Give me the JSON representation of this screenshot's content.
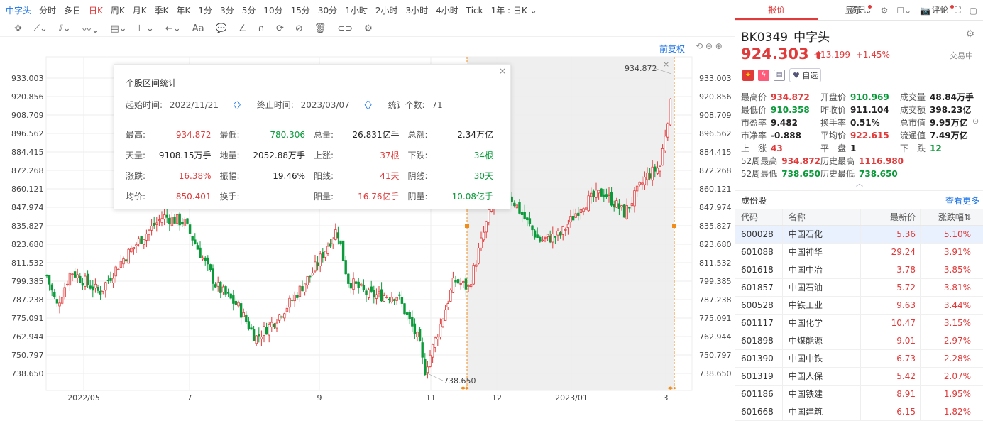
{
  "topbar": {
    "items": [
      {
        "label": "中字头",
        "state": "active"
      },
      {
        "label": "分时"
      },
      {
        "label": "多日"
      },
      {
        "label": "日K",
        "state": "red"
      },
      {
        "label": "周K"
      },
      {
        "label": "月K"
      },
      {
        "label": "季K"
      },
      {
        "label": "年K"
      },
      {
        "label": "1分"
      },
      {
        "label": "3分"
      },
      {
        "label": "5分"
      },
      {
        "label": "10分"
      },
      {
        "label": "15分"
      },
      {
        "label": "30分"
      },
      {
        "label": "1小时"
      },
      {
        "label": "2小时"
      },
      {
        "label": "3小时"
      },
      {
        "label": "4小时"
      },
      {
        "label": "Tick"
      },
      {
        "label": "1年 : 日K ⌄"
      }
    ],
    "display_label": "显示 ⌄"
  },
  "chart": {
    "restore_label": "前复权",
    "y_ticks": [
      "933.003",
      "920.856",
      "908.709",
      "896.562",
      "884.415",
      "872.268",
      "860.121",
      "847.974",
      "835.827",
      "823.680",
      "811.532",
      "799.385",
      "787.238",
      "775.091",
      "762.944",
      "750.797",
      "738.650"
    ],
    "x_ticks": [
      "2022/05",
      "7",
      "9",
      "11",
      "12",
      "2023/01",
      "3"
    ],
    "high_marker": "934.872",
    "low_marker": "738.650"
  },
  "popup": {
    "title": "个股区间统计",
    "start_label": "起始时间:",
    "start_value": "2022/11/21",
    "end_label": "终止时间:",
    "end_value": "2023/03/07",
    "count_label": "统计个数:",
    "count_value": "71",
    "rows": [
      [
        {
          "k": "最高:",
          "v": "934.872",
          "c": "red"
        },
        {
          "k": "最低:",
          "v": "780.306",
          "c": "green"
        },
        {
          "k": "总量:",
          "v": "26.831亿手",
          "c": "blk"
        },
        {
          "k": "总额:",
          "v": "2.34万亿",
          "c": "blk"
        }
      ],
      [
        {
          "k": "天量:",
          "v": "9108.15万手",
          "c": "blk"
        },
        {
          "k": "地量:",
          "v": "2052.88万手",
          "c": "blk"
        },
        {
          "k": "上涨:",
          "v": "37根",
          "c": "red"
        },
        {
          "k": "下跌:",
          "v": "34根",
          "c": "green"
        }
      ],
      [
        {
          "k": "涨跌:",
          "v": "16.38%",
          "c": "red"
        },
        {
          "k": "振幅:",
          "v": "19.46%",
          "c": "blk"
        },
        {
          "k": "阳线:",
          "v": "41天",
          "c": "red"
        },
        {
          "k": "阴线:",
          "v": "30天",
          "c": "green"
        }
      ],
      [
        {
          "k": "均价:",
          "v": "850.401",
          "c": "red"
        },
        {
          "k": "换手:",
          "v": "--",
          "c": "blk"
        },
        {
          "k": "阳量:",
          "v": "16.76亿手",
          "c": "red"
        },
        {
          "k": "阴量:",
          "v": "10.08亿手",
          "c": "green"
        }
      ]
    ]
  },
  "right": {
    "tabs": [
      "报价",
      "资讯",
      "评论"
    ],
    "code": "BK0349",
    "name": "中字头",
    "price": "924.303",
    "arrow": "⬆",
    "change": "+13.199",
    "change_pct": "+1.45%",
    "status": "交易中",
    "watch_label": "自选",
    "stats": [
      [
        {
          "k": "最高价",
          "v": "934.872",
          "c": "red"
        },
        {
          "k": "开盘价",
          "v": "910.969",
          "c": "green"
        },
        {
          "k": "成交量",
          "v": "48.84万手",
          "c": "blk"
        }
      ],
      [
        {
          "k": "最低价",
          "v": "910.358",
          "c": "green"
        },
        {
          "k": "昨收价",
          "v": "911.104",
          "c": "blk"
        },
        {
          "k": "成交额",
          "v": "398.23亿",
          "c": "blk"
        }
      ],
      [
        {
          "k": "市盈率",
          "v": "9.482",
          "c": "blk"
        },
        {
          "k": "换手率",
          "v": "0.51%",
          "c": "blk"
        },
        {
          "k": "总市值",
          "v": "9.95万亿",
          "c": "blk"
        }
      ],
      [
        {
          "k": "市净率",
          "v": "-0.888",
          "c": "blk"
        },
        {
          "k": "平均价",
          "v": "922.615",
          "c": "red"
        },
        {
          "k": "流通值",
          "v": "7.49万亿",
          "c": "blk"
        }
      ],
      [
        {
          "k": "上　涨",
          "v": "43",
          "c": "red"
        },
        {
          "k": "平　盘",
          "v": "1",
          "c": "blk"
        },
        {
          "k": "下　跌",
          "v": "12",
          "c": "green"
        }
      ],
      [
        {
          "k": "52周最高",
          "v": "934.872",
          "c": "red"
        },
        {
          "k": "历史最高",
          "v": "1116.980",
          "c": "red"
        },
        {
          "k": "",
          "v": "",
          "c": "blk"
        }
      ],
      [
        {
          "k": "52周最低",
          "v": "738.650",
          "c": "green"
        },
        {
          "k": "历史最低",
          "v": "738.650",
          "c": "green"
        },
        {
          "k": "",
          "v": "",
          "c": "blk"
        }
      ]
    ],
    "constituents_title": "成份股",
    "more_label": "查看更多",
    "table_headers": [
      "代码",
      "名称",
      "最新价",
      "涨跌幅"
    ],
    "rows": [
      [
        "600028",
        "中国石化",
        "5.36",
        "5.10%"
      ],
      [
        "601088",
        "中国神华",
        "29.24",
        "3.91%"
      ],
      [
        "601618",
        "中国中冶",
        "3.78",
        "3.85%"
      ],
      [
        "601857",
        "中国石油",
        "5.72",
        "3.81%"
      ],
      [
        "600528",
        "中铁工业",
        "9.63",
        "3.44%"
      ],
      [
        "601117",
        "中国化学",
        "10.47",
        "3.15%"
      ],
      [
        "601898",
        "中煤能源",
        "9.01",
        "2.97%"
      ],
      [
        "601390",
        "中国中铁",
        "6.73",
        "2.28%"
      ],
      [
        "601319",
        "中国人保",
        "5.42",
        "2.07%"
      ],
      [
        "601186",
        "中国铁建",
        "8.91",
        "1.95%"
      ],
      [
        "601668",
        "中国建筑",
        "6.15",
        "1.82%"
      ]
    ]
  }
}
